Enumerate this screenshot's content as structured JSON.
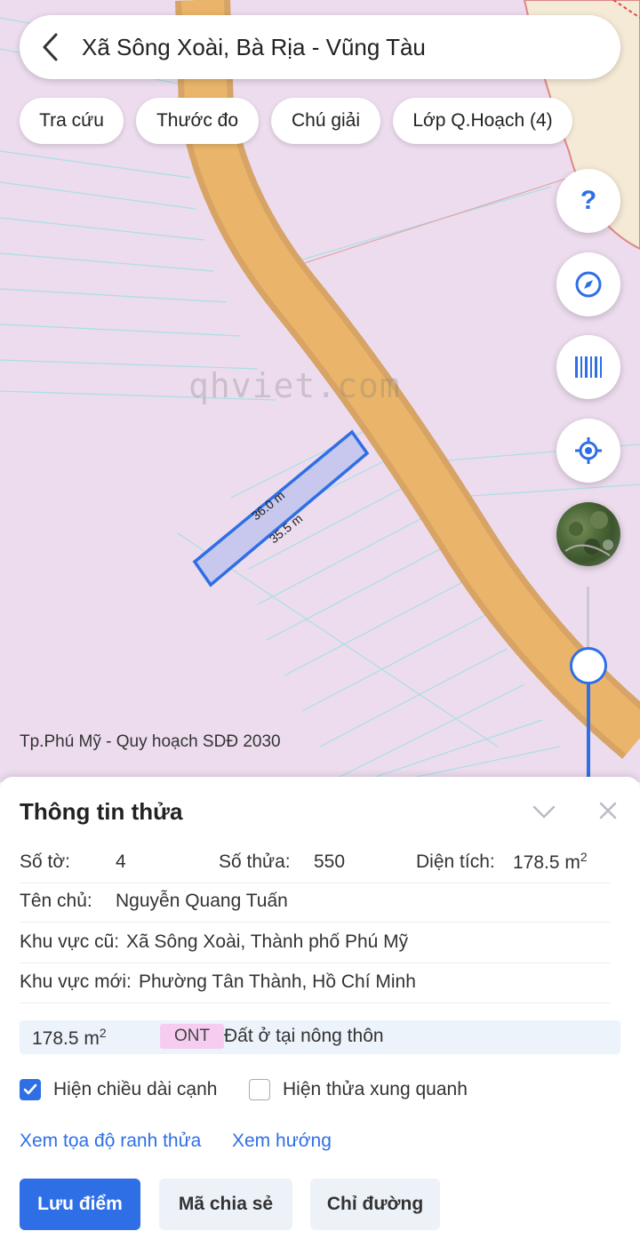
{
  "search": {
    "title": "Xã Sông Xoài, Bà Rịa - Vũng Tàu"
  },
  "chips": [
    {
      "label": "Tra cứu"
    },
    {
      "label": "Thước đo"
    },
    {
      "label": "Chú giải"
    },
    {
      "label": "Lớp Q.Hoạch (4)"
    }
  ],
  "map": {
    "watermark": "qhviet.com",
    "caption": "Tp.Phú Mỹ - Quy hoạch SDĐ 2030",
    "edge_labels": [
      "36.0 m",
      "35.5 m"
    ],
    "zoom_level": 0.6,
    "colors": {
      "land": "#ecdcee",
      "road": "#e9b56c",
      "parcel": "#c8c8ee",
      "parcel_border": "#2f6fe6"
    }
  },
  "side_buttons": {
    "help": "help-icon",
    "compass": "compass-icon",
    "barcode": "barcode-icon",
    "locate": "locate-icon",
    "layer": "satellite-layer"
  },
  "panel": {
    "title": "Thông tin thửa",
    "so_to_label": "Số tờ:",
    "so_to": "4",
    "so_thua_label": "Số thửa:",
    "so_thua": "550",
    "dien_tich_label": "Diện tích:",
    "dien_tich": "178.5 m",
    "unit_sup": "2",
    "ten_chu_label": "Tên chủ:",
    "ten_chu": "Nguyễn Quang Tuấn",
    "khu_vuc_cu_label": "Khu vực cũ:",
    "khu_vuc_cu": "Xã Sông Xoài, Thành phố Phú Mỹ",
    "khu_vuc_moi_label": "Khu vực mới:",
    "khu_vuc_moi": "Phường Tân Thành, Hồ Chí Minh",
    "land_area": "178.5 m",
    "land_code": "ONT",
    "land_desc": "Đất ở tại nông thôn",
    "check_edges": "Hiện chiều dài cạnh",
    "check_edges_on": true,
    "check_neighbors": "Hiện thửa xung quanh",
    "check_neighbors_on": false,
    "link_coords": "Xem tọa độ ranh thửa",
    "link_direction": "Xem hướng",
    "btn_save": "Lưu điểm",
    "btn_share": "Mã chia sẻ",
    "btn_route": "Chỉ đường"
  }
}
